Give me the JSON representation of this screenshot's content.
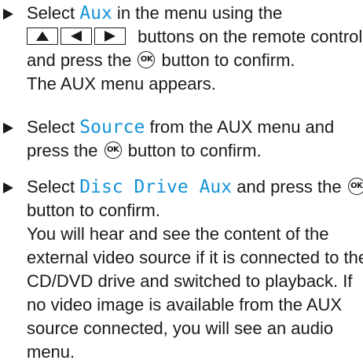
{
  "steps": [
    {
      "pre": "Select ",
      "highlight": "Aux",
      "post_a": " in the menu using the",
      "post_b": " buttons on the remote control and press the ",
      "post_c": " button to confirm.",
      "result": "The AUX menu appears."
    },
    {
      "pre": "Select ",
      "highlight": "Source",
      "post_a": " from the AUX menu and press the ",
      "post_b": " button to confirm."
    },
    {
      "pre": "Select ",
      "highlight": "Disc Drive Aux",
      "post_a": " and press the ",
      "post_b": " button to confirm.",
      "result": "You will hear and see the content of the external video source if it is connected to the CD/DVD drive and switched to playback. If no video image is available from the AUX source connected, you will see an audio menu."
    }
  ],
  "ok_icon_label": "OK",
  "icons": {
    "up": "triangle-up-icon",
    "left": "triangle-left-icon",
    "right": "triangle-right-icon",
    "ok": "ok-button-icon",
    "bullet": "bullet-arrow-icon"
  },
  "colors": {
    "highlight": "#1493d8",
    "text": "#1a1a1a"
  }
}
